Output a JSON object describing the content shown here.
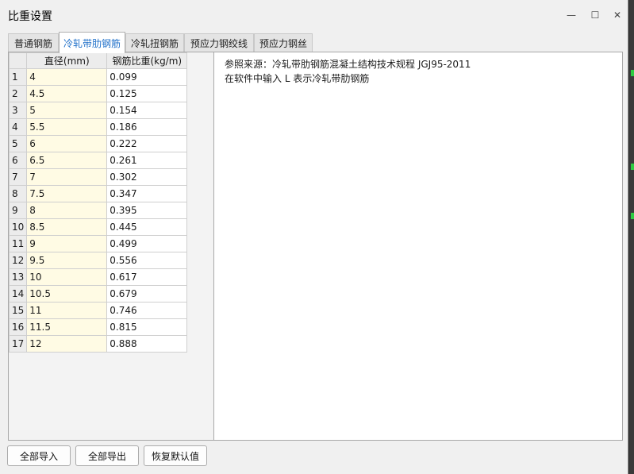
{
  "window": {
    "title": "比重设置",
    "minimize_glyph": "—",
    "maximize_glyph": "☐",
    "close_glyph": "✕"
  },
  "tabs": [
    {
      "label": "普通钢筋",
      "active": false
    },
    {
      "label": "冷轧带肋钢筋",
      "active": true
    },
    {
      "label": "冷轧扭钢筋",
      "active": false
    },
    {
      "label": "预应力钢绞线",
      "active": false
    },
    {
      "label": "预应力钢丝",
      "active": false
    }
  ],
  "table": {
    "columns": [
      "直径(mm)",
      "钢筋比重(kg/m)"
    ],
    "rows": [
      {
        "n": "1",
        "d": "4",
        "w": "0.099"
      },
      {
        "n": "2",
        "d": "4.5",
        "w": "0.125"
      },
      {
        "n": "3",
        "d": "5",
        "w": "0.154"
      },
      {
        "n": "4",
        "d": "5.5",
        "w": "0.186"
      },
      {
        "n": "5",
        "d": "6",
        "w": "0.222"
      },
      {
        "n": "6",
        "d": "6.5",
        "w": "0.261"
      },
      {
        "n": "7",
        "d": "7",
        "w": "0.302"
      },
      {
        "n": "8",
        "d": "7.5",
        "w": "0.347"
      },
      {
        "n": "9",
        "d": "8",
        "w": "0.395"
      },
      {
        "n": "10",
        "d": "8.5",
        "w": "0.445"
      },
      {
        "n": "11",
        "d": "9",
        "w": "0.499"
      },
      {
        "n": "12",
        "d": "9.5",
        "w": "0.556"
      },
      {
        "n": "13",
        "d": "10",
        "w": "0.617"
      },
      {
        "n": "14",
        "d": "10.5",
        "w": "0.679"
      },
      {
        "n": "15",
        "d": "11",
        "w": "0.746"
      },
      {
        "n": "16",
        "d": "11.5",
        "w": "0.815"
      },
      {
        "n": "17",
        "d": "12",
        "w": "0.888"
      }
    ]
  },
  "info": {
    "line1": "参照来源：冷轧带肋钢筋混凝土结构技术规程 JGJ95-2011",
    "line2": "在软件中输入 L 表示冷轧带肋钢筋"
  },
  "buttons": {
    "import_all": "全部导入",
    "export_all": "全部导出",
    "restore_default": "恢复默认值"
  },
  "colors": {
    "active_tab_text": "#1e6fc9",
    "diameter_cell_bg": "#fffbe4"
  }
}
